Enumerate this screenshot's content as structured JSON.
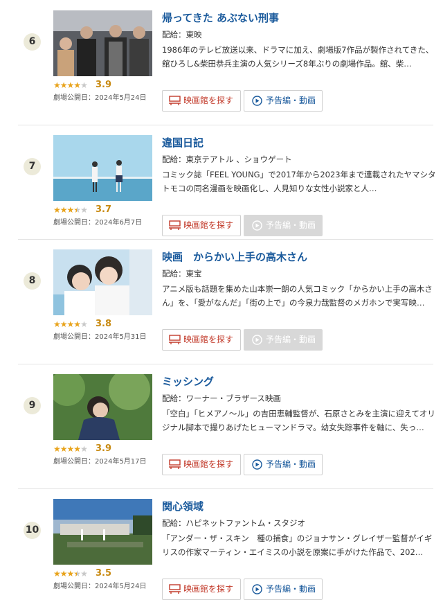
{
  "colors": {
    "title": "#1a5a9c",
    "star_on": "#e8a31b",
    "score": "#c88a12",
    "theater_red": "#c23a2a",
    "rank_bg": "#ecead9",
    "disabled_btn": "#d8d8d8"
  },
  "items": [
    {
      "rank": "6",
      "title": "帰ってきた あぶない刑事",
      "distributor": "配給：東映",
      "description": "1986年のテレビ放送以来、ドラマに加え、劇場版7作品が製作されてきた、舘ひろし&柴田恭兵主演の人気シリーズ8年ぶりの劇場作品。舘、柴…",
      "rating": 3.9,
      "rating_label": "3.9",
      "stars_full": 4,
      "stars_half": 0,
      "release": "劇場公開日：2024年5月24日",
      "theater_label": "映画館を探す",
      "trailer_label": "予告編・動画",
      "trailer_enabled": true,
      "poster_icon": "poster-image"
    },
    {
      "rank": "7",
      "title": "違国日記",
      "distributor": "配給：東京テアトル 、ショウゲート",
      "description": "コミック誌「FEEL YOUNG」で2017年から2023年まで連載されたヤマシタトモコの同名漫画を映画化し、人見知りな女性小説家と人…",
      "rating": 3.7,
      "rating_label": "3.7",
      "stars_full": 3,
      "stars_half": 1,
      "release": "劇場公開日：2024年6月7日",
      "theater_label": "映画館を探す",
      "trailer_label": "予告編・動画",
      "trailer_enabled": false,
      "poster_icon": "poster-image"
    },
    {
      "rank": "8",
      "title": "映画　からかい上手の高木さん",
      "distributor": "配給：東宝",
      "description": "アニメ版も話題を集めた山本崇一朗の人気コミック「からかい上手の高木さん」を、「愛がなんだ」「街の上で」の今泉力哉監督のメガホンで実写映…",
      "rating": 3.8,
      "rating_label": "3.8",
      "stars_full": 4,
      "stars_half": 0,
      "release": "劇場公開日：2024年5月31日",
      "theater_label": "映画館を探す",
      "trailer_label": "予告編・動画",
      "trailer_enabled": false,
      "poster_icon": "poster-image"
    },
    {
      "rank": "9",
      "title": "ミッシング",
      "distributor": "配給：ワーナー・ブラザース映画",
      "description": "「空白」「ヒメアノ～ル」の吉田恵輔監督が、石原さとみを主演に迎えてオリジナル脚本で撮りあげたヒューマンドラマ。幼女失踪事件を軸に、失っ…",
      "rating": 3.9,
      "rating_label": "3.9",
      "stars_full": 4,
      "stars_half": 0,
      "release": "劇場公開日：2024年5月17日",
      "theater_label": "映画館を探す",
      "trailer_label": "予告編・動画",
      "trailer_enabled": true,
      "poster_icon": "poster-image"
    },
    {
      "rank": "10",
      "title": "関心領域",
      "distributor": "配給：ハピネットファントム・スタジオ",
      "description": "「アンダー・ザ・スキン　種の捕食」のジョナサン・グレイザー監督がイギリスの作家マーティン・エイミスの小説を原案に手がけた作品で、202…",
      "rating": 3.5,
      "rating_label": "3.5",
      "stars_full": 3,
      "stars_half": 1,
      "release": "劇場公開日：2024年5月24日",
      "theater_label": "映画館を探す",
      "trailer_label": "予告編・動画",
      "trailer_enabled": true,
      "poster_icon": "poster-image"
    }
  ]
}
